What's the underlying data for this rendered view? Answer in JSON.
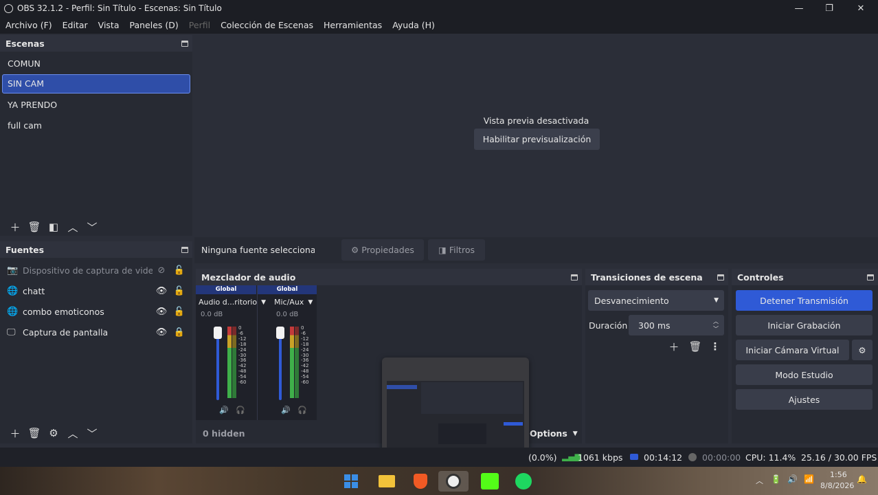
{
  "window": {
    "title": "OBS 32.1.2 - Perfil: Sin Título - Escenas: Sin Título",
    "minimize": "—",
    "maximize": "❐",
    "close": "✕"
  },
  "menu": [
    "Archivo (F)",
    "Editar",
    "Vista",
    "Paneles (D)",
    "Perfil",
    "Colección de Escenas",
    "Herramientas",
    "Ayuda (H)"
  ],
  "preview": {
    "status": "Vista previa desactivada",
    "enable_button": "Habilitar previsualización"
  },
  "scenes": {
    "title": "Escenas",
    "items": [
      "COMUN",
      "SIN CAM",
      "YA PRENDO",
      "full cam"
    ],
    "selected": "SIN CAM"
  },
  "sources": {
    "title": "Fuentes",
    "items": [
      {
        "name": "Dispositivo de captura de video",
        "icon": "camera-icon",
        "visible": false,
        "locked": false
      },
      {
        "name": "chatt",
        "icon": "globe-icon",
        "visible": true,
        "locked": false
      },
      {
        "name": "combo emoticonos",
        "icon": "globe-icon",
        "visible": true,
        "locked": false
      },
      {
        "name": "Captura de pantalla",
        "icon": "monitor-icon",
        "visible": true,
        "locked": true
      }
    ]
  },
  "source_bar": {
    "none_selected": "Ninguna fuente seleccionad",
    "properties": "Propiedades",
    "filters": "Filtros"
  },
  "mixer": {
    "title": "Mezclador de audio",
    "hidden": "0 hidden",
    "options": "Options",
    "channels": [
      {
        "badge": "Global",
        "name": "Audio d...ritorio",
        "db": "0.0 dB",
        "level": 0.9
      },
      {
        "badge": "Global",
        "name": "Mic/Aux",
        "db": "0.0 dB",
        "level": 0.9
      }
    ],
    "scale": [
      "0",
      "-6",
      "-12",
      "-18",
      "-24",
      "-30",
      "-36",
      "-42",
      "-48",
      "-54",
      "-60"
    ]
  },
  "transitions": {
    "title": "Transiciones de escena",
    "selected": "Desvanecimiento",
    "duration_label": "Duración",
    "duration": "300 ms"
  },
  "controls": {
    "title": "Controles",
    "stop_stream": "Detener Transmisión",
    "start_recording": "Iniciar Grabación",
    "start_virtual_cam": "Iniciar Cámara Virtual",
    "studio_mode": "Modo Estudio",
    "settings": "Ajustes"
  },
  "status": {
    "dropped": "(0.0%)",
    "bitrate": "1061 kbps",
    "stream_time": "00:14:12",
    "rec_time": "00:00:00",
    "cpu": "CPU: 11.4%",
    "fps": "25.16 / 30.00 FPS"
  },
  "taskbar": {
    "time": "1:56",
    "date": "8/8/2026"
  },
  "colors": {
    "accent": "#2f5ad6",
    "selection": "#2f4ea8",
    "meter_green": "#3fb04a",
    "meter_yellow": "#c9a227",
    "meter_red": "#c43a3a"
  }
}
